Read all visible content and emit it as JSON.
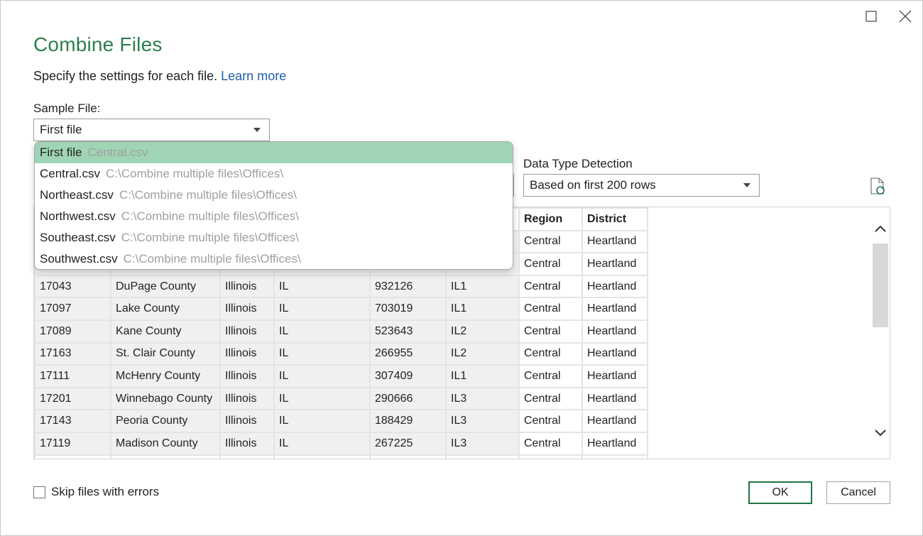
{
  "window": {
    "maximize_icon": "maximize-icon",
    "close_icon": "close-icon"
  },
  "title": "Combine Files",
  "subtitle": {
    "text": "Specify the settings for each file.",
    "link": "Learn more"
  },
  "sample_file": {
    "label": "Sample File:",
    "value": "First file"
  },
  "dropdown": {
    "items": [
      {
        "name": "First file",
        "path": "Central.csv",
        "selected": true
      },
      {
        "name": "Central.csv",
        "path": "C:\\Combine multiple files\\Offices\\"
      },
      {
        "name": "Northeast.csv",
        "path": "C:\\Combine multiple files\\Offices\\"
      },
      {
        "name": "Northwest.csv",
        "path": "C:\\Combine multiple files\\Offices\\"
      },
      {
        "name": "Southeast.csv",
        "path": "C:\\Combine multiple files\\Offices\\"
      },
      {
        "name": "Southwest.csv",
        "path": "C:\\Combine multiple files\\Offices\\"
      }
    ]
  },
  "data_type_detection": {
    "label": "Data Type Detection",
    "value": "Based on first 200 rows"
  },
  "grid": {
    "headers": [
      "",
      "",
      "",
      "",
      "",
      "",
      "Region",
      "District"
    ],
    "rows": [
      [
        "",
        "",
        "",
        "",
        "",
        "",
        "Central",
        "Heartland"
      ],
      [
        "",
        "",
        "",
        "",
        "",
        "",
        "Central",
        "Heartland"
      ],
      [
        "17043",
        "DuPage County",
        "Illinois",
        "IL",
        "932126",
        "IL1",
        "Central",
        "Heartland"
      ],
      [
        "17097",
        "Lake County",
        "Illinois",
        "IL",
        "703019",
        "IL1",
        "Central",
        "Heartland"
      ],
      [
        "17089",
        "Kane County",
        "Illinois",
        "IL",
        "523643",
        "IL2",
        "Central",
        "Heartland"
      ],
      [
        "17163",
        "St. Clair County",
        "Illinois",
        "IL",
        "266955",
        "IL2",
        "Central",
        "Heartland"
      ],
      [
        "17111",
        "McHenry County",
        "Illinois",
        "IL",
        "307409",
        "IL1",
        "Central",
        "Heartland"
      ],
      [
        "17201",
        "Winnebago County",
        "Illinois",
        "IL",
        "290666",
        "IL3",
        "Central",
        "Heartland"
      ],
      [
        "17143",
        "Peoria County",
        "Illinois",
        "IL",
        "188429",
        "IL3",
        "Central",
        "Heartland"
      ],
      [
        "17119",
        "Madison County",
        "Illinois",
        "IL",
        "267225",
        "IL3",
        "Central",
        "Heartland"
      ]
    ]
  },
  "skip_errors": {
    "label": "Skip files with errors",
    "checked": false
  },
  "buttons": {
    "ok": "OK",
    "cancel": "Cancel"
  },
  "colors": {
    "title": "#2e7d4f",
    "link": "#1f5fa8",
    "selected_item": "#9fd5b5",
    "ok_border": "#217346"
  }
}
